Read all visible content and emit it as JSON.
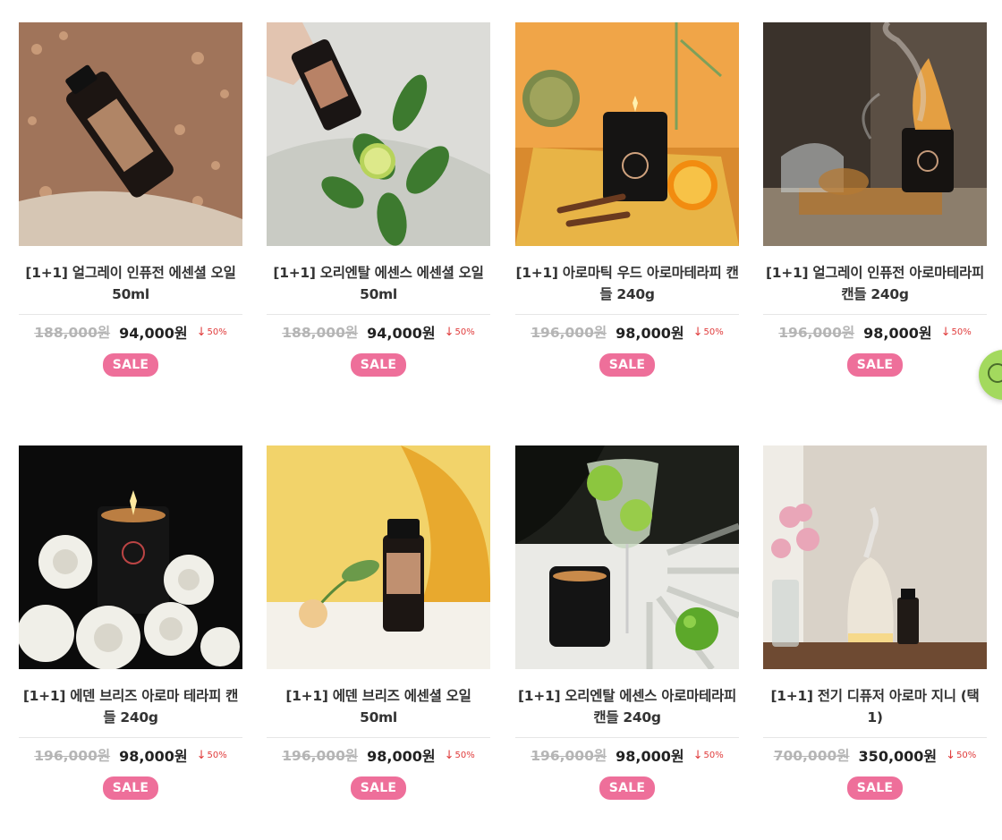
{
  "products": [
    {
      "title": "[1+1] 얼그레이 인퓨전 에센셜 오일 50ml",
      "original_price": "188,000원",
      "sale_price": "94,000원",
      "discount": "50%",
      "badge": "SALE",
      "image": "dark-oil-bottle-on-gravel"
    },
    {
      "title": "[1+1] 오리엔탈 에센스 에센셜 오일 50ml",
      "original_price": "188,000원",
      "sale_price": "94,000원",
      "discount": "50%",
      "badge": "SALE",
      "image": "hand-pouring-oil-with-lime-leaves"
    },
    {
      "title": "[1+1] 아로마틱 우드 아로마테라피 캔들 240g",
      "original_price": "196,000원",
      "sale_price": "98,000원",
      "discount": "50%",
      "badge": "SALE",
      "image": "candle-with-orange-and-spices"
    },
    {
      "title": "[1+1] 얼그레이 인퓨전 아로마테라피 캔들 240g",
      "original_price": "196,000원",
      "sale_price": "98,000원",
      "discount": "50%",
      "badge": "SALE",
      "image": "candle-with-tea-and-smoke"
    },
    {
      "title": "[1+1] 에덴 브리즈 아로마 테라피 캔들 240g",
      "original_price": "196,000원",
      "sale_price": "98,000원",
      "discount": "50%",
      "badge": "SALE",
      "image": "candle-with-white-roses"
    },
    {
      "title": "[1+1] 에덴 브리즈 에센셜 오일 50ml",
      "original_price": "196,000원",
      "sale_price": "98,000원",
      "discount": "50%",
      "badge": "SALE",
      "image": "oil-bottle-yellow-backdrop"
    },
    {
      "title": "[1+1] 오리엔탈 에센스 아로마테라피 캔들 240g",
      "original_price": "196,000원",
      "sale_price": "98,000원",
      "discount": "50%",
      "badge": "SALE",
      "image": "candle-with-lime-drink"
    },
    {
      "title": "[1+1] 전기 디퓨저 아로마 지니 (택1)",
      "original_price": "700,000원",
      "sale_price": "350,000원",
      "discount": "50%",
      "badge": "SALE",
      "image": "white-diffuser-with-flowers"
    }
  ],
  "discount_arrow": "↓",
  "side_button": {
    "icon": "chat-icon"
  },
  "colors": {
    "badge": "#ee6f9a",
    "discount": "#e03c3c",
    "strike": "#b5b5b5",
    "side_button": "#a3d95e"
  }
}
